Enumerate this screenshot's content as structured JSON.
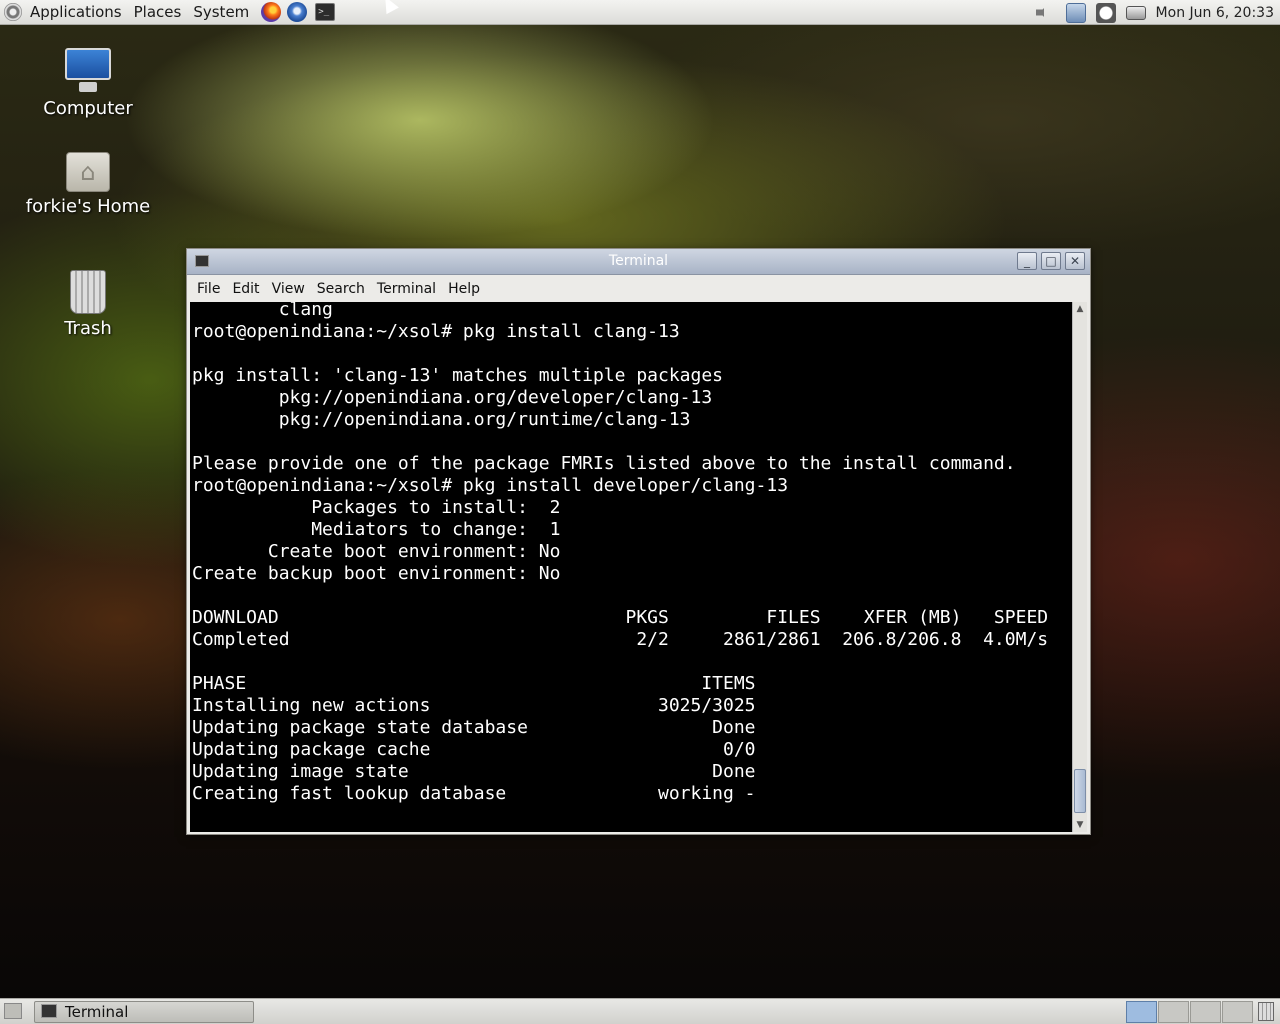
{
  "top_panel": {
    "menus": [
      "Applications",
      "Places",
      "System"
    ],
    "clock": "Mon Jun  6, 20:33"
  },
  "desktop_icons": {
    "computer": "Computer",
    "home": "forkie's Home",
    "trash": "Trash"
  },
  "terminal_window": {
    "title": "Terminal",
    "menu": [
      "File",
      "Edit",
      "View",
      "Search",
      "Terminal",
      "Help"
    ],
    "output": "        clang\nroot@openindiana:~/xsol# pkg install clang-13\n\npkg install: 'clang-13' matches multiple packages\n        pkg://openindiana.org/developer/clang-13\n        pkg://openindiana.org/runtime/clang-13\n\nPlease provide one of the package FMRIs listed above to the install command.\nroot@openindiana:~/xsol# pkg install developer/clang-13\n           Packages to install:  2\n           Mediators to change:  1\n       Create boot environment: No\nCreate backup boot environment: No\n\nDOWNLOAD                                PKGS         FILES    XFER (MB)   SPEED\nCompleted                                2/2     2861/2861  206.8/206.8  4.0M/s\n\nPHASE                                          ITEMS\nInstalling new actions                     3025/3025\nUpdating package state database                 Done\nUpdating package cache                           0/0\nUpdating image state                            Done\nCreating fast lookup database              working -"
  },
  "bottom_panel": {
    "task": "Terminal"
  }
}
